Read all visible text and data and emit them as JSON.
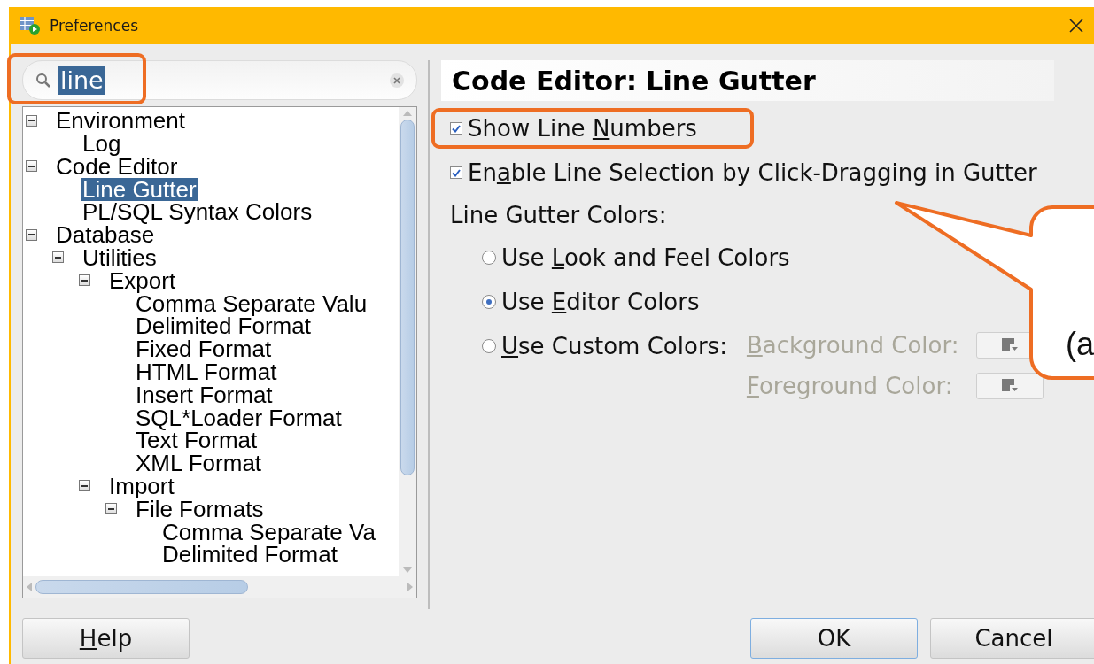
{
  "window": {
    "title": "Preferences"
  },
  "search": {
    "value": "line",
    "text_selected": true,
    "highlighted": true
  },
  "tree": [
    {
      "label": "Environment",
      "expanded": true,
      "selected": false,
      "children": [
        {
          "label": "Log",
          "selected": false
        }
      ]
    },
    {
      "label": "Code Editor",
      "expanded": true,
      "selected": false,
      "children": [
        {
          "label": "Line Gutter",
          "selected": true
        },
        {
          "label": "PL/SQL Syntax Colors",
          "selected": false
        }
      ]
    },
    {
      "label": "Database",
      "expanded": true,
      "selected": false,
      "children": [
        {
          "label": "Utilities",
          "expanded": true,
          "selected": false,
          "children": [
            {
              "label": "Export",
              "expanded": true,
              "selected": false,
              "children": [
                {
                  "label": "Comma Separate Valu",
                  "selected": false
                },
                {
                  "label": "Delimited Format",
                  "selected": false
                },
                {
                  "label": "Fixed Format",
                  "selected": false
                },
                {
                  "label": "HTML Format",
                  "selected": false
                },
                {
                  "label": "Insert Format",
                  "selected": false
                },
                {
                  "label": "SQL*Loader Format",
                  "selected": false
                },
                {
                  "label": "Text Format",
                  "selected": false
                },
                {
                  "label": "XML Format",
                  "selected": false
                }
              ]
            },
            {
              "label": "Import",
              "expanded": true,
              "selected": false,
              "children": [
                {
                  "label": "File Formats",
                  "expanded": true,
                  "selected": false,
                  "children": [
                    {
                      "label": "Comma Separate Va",
                      "selected": false
                    },
                    {
                      "label": "Delimited Format",
                      "selected": false
                    }
                  ]
                }
              ]
            }
          ]
        }
      ]
    }
  ],
  "panel": {
    "title": "Code Editor: Line Gutter",
    "options": [
      {
        "kind": "checkbox",
        "label": [
          {
            "text": "Show Line ",
            "underlined": false
          },
          {
            "text": "N",
            "underlined": true
          },
          {
            "text": "umbers",
            "underlined": false
          }
        ],
        "checked": true,
        "highlighted": true
      },
      {
        "kind": "checkbox",
        "label": [
          {
            "text": "En",
            "underlined": false
          },
          {
            "text": "a",
            "underlined": true
          },
          {
            "text": "ble Line Selection by Click-Dragging in Gutter",
            "underlined": false
          }
        ],
        "checked": true,
        "highlighted": false
      },
      {
        "kind": "heading",
        "label": [
          {
            "text": "Line Gutter Colors:",
            "underlined": false
          }
        ]
      },
      {
        "kind": "radio",
        "label": [
          {
            "text": "Use ",
            "underlined": false
          },
          {
            "text": "L",
            "underlined": true
          },
          {
            "text": "ook and Feel Colors",
            "underlined": false
          }
        ],
        "selected": false
      },
      {
        "kind": "radio",
        "label": [
          {
            "text": "Use ",
            "underlined": false
          },
          {
            "text": "E",
            "underlined": true
          },
          {
            "text": "ditor Colors",
            "underlined": false
          }
        ],
        "selected": true
      },
      {
        "kind": "radio",
        "label": [
          {
            "text": "U",
            "underlined": true
          },
          {
            "text": "se Custom Colors:",
            "underlined": false
          }
        ],
        "selected": false,
        "pickers": [
          {
            "label": [
              {
                "text": "B",
                "underlined": true
              },
              {
                "text": "ackground Color:",
                "underlined": false
              }
            ],
            "disabled": true
          },
          {
            "label": [
              {
                "text": "F",
                "underlined": true
              },
              {
                "text": "oreground Color:",
                "underlined": false
              }
            ],
            "disabled": true
          }
        ]
      }
    ]
  },
  "callout": {
    "text": "(a"
  },
  "buttons": [
    {
      "label": [
        {
          "text": "H",
          "underlined": true
        },
        {
          "text": "elp",
          "underlined": false
        }
      ],
      "default": false
    },
    {
      "label": [
        {
          "text": "OK",
          "underlined": false
        }
      ],
      "default": true
    },
    {
      "label": [
        {
          "text": "Cancel",
          "underlined": false
        }
      ],
      "default": false
    }
  ]
}
